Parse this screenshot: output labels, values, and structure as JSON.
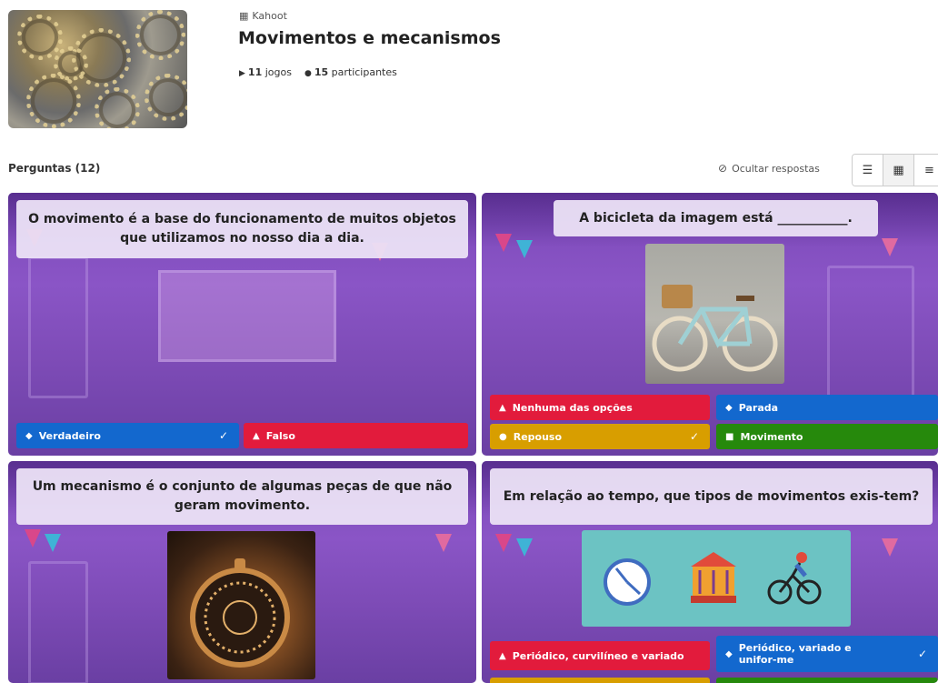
{
  "header": {
    "source_label": "Kahoot",
    "title": "Movimentos e mecanismos",
    "plays_count": "11",
    "plays_label": "jogos",
    "participants_count": "15",
    "participants_label": "participantes"
  },
  "questions_section": {
    "title": "Perguntas (12)",
    "hide_answers_label": "Ocultar respostas"
  },
  "icons": {
    "kahoot": "kahoot-icon",
    "play": "play-icon",
    "participants": "user-icon",
    "hide": "eye-off-icon",
    "view_list": "list-view-icon",
    "view_grid": "grid-view-icon",
    "view_detail": "detail-view-icon"
  },
  "colors": {
    "red": "#e21b3c",
    "blue": "#1368ce",
    "yellow": "#d89e00",
    "green": "#26890c",
    "card_purple": "#7b48b8"
  },
  "cards": [
    {
      "question": "O movimento é a base do funcionamento de muitos objetos que utilizamos no nosso dia a dia.",
      "answers": [
        {
          "label": "Verdadeiro",
          "shape": "◆",
          "color": "blue",
          "correct": true
        },
        {
          "label": "Falso",
          "shape": "▲",
          "color": "red",
          "correct": false
        }
      ]
    },
    {
      "question": "A bicicleta da imagem está ___________.",
      "answers": [
        {
          "label": "Nenhuma das opções",
          "shape": "▲",
          "color": "red",
          "correct": false
        },
        {
          "label": "Parada",
          "shape": "◆",
          "color": "blue",
          "correct": false
        },
        {
          "label": "Repouso",
          "shape": "●",
          "color": "yellow",
          "correct": true
        },
        {
          "label": "Movimento",
          "shape": "■",
          "color": "green",
          "correct": false
        }
      ]
    },
    {
      "question": "Um mecanismo é o conjunto de algumas peças de que não geram movimento.",
      "answers": []
    },
    {
      "question": "Em relação ao tempo, que tipos de movimentos exis-tem?",
      "answers": [
        {
          "label": "Periódico, curvilíneo e variado",
          "shape": "▲",
          "color": "red",
          "correct": false
        },
        {
          "label": "Periódico, variado e unifor-me",
          "shape": "◆",
          "color": "blue",
          "correct": true
        }
      ]
    }
  ],
  "glyphs": {
    "check": "✓",
    "play": "▶",
    "user": "👤",
    "kahoot": "▦",
    "eye_off": "⊘",
    "view_list": "☰",
    "view_grid": "▦",
    "view_detail": "≡"
  }
}
